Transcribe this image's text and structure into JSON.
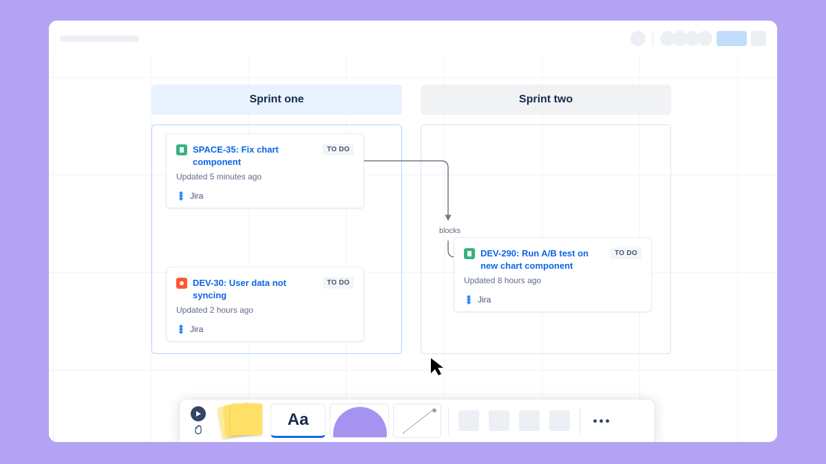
{
  "sections": {
    "one": {
      "title": "Sprint one"
    },
    "two": {
      "title": "Sprint two"
    }
  },
  "cards": {
    "space35": {
      "title": "SPACE-35: Fix chart component",
      "status": "TO DO",
      "updated": "Updated 5 minutes ago",
      "source": "Jira"
    },
    "dev30": {
      "title": "DEV-30: User data not syncing",
      "status": "TO DO",
      "updated": "Updated 2 hours ago",
      "source": "Jira"
    },
    "dev290": {
      "title": "DEV-290: Run A/B test on new chart component",
      "status": "TO DO",
      "updated": "Updated 8 hours ago",
      "source": "Jira"
    }
  },
  "connector": {
    "label": "blocks"
  },
  "toolbar": {
    "text_label": "Aa"
  }
}
